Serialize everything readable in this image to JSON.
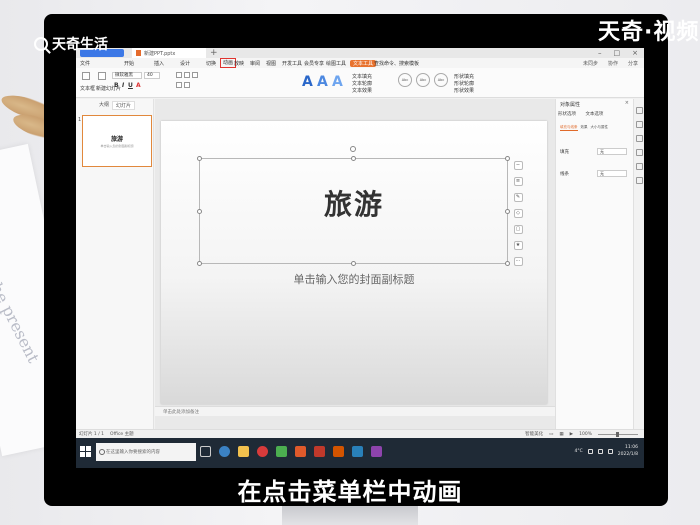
{
  "watermark": {
    "top_left": "天奇生活",
    "top_right": "天奇·视频"
  },
  "caption": "在点击菜单栏中动画",
  "app": {
    "doc_tab": "新建PPT.pptx",
    "menu": [
      "文件",
      "开始",
      "插入",
      "设计",
      "切换",
      "动画",
      "放映",
      "审阅",
      "视图",
      "开发工具",
      "会员专享",
      "绘图工具",
      "文本工具"
    ],
    "search": "查找命令、搜索模板",
    "right_menu": [
      "未同步",
      "协作",
      "分享"
    ],
    "ribbon": {
      "font_name": "微软雅黑",
      "font_size": "40",
      "new_slide": "新建幻灯片",
      "text_box": "文本框",
      "art_letters": [
        "A",
        "A",
        "A"
      ],
      "text_fill": "文本填充",
      "text_outline": "文本轮廓",
      "text_effect": "文本效果",
      "shape_fill": "形状填充",
      "shape_outline": "形状轮廓",
      "shape_effect": "形状效果",
      "style_boxes": [
        "Abc",
        "Abc",
        "Abc"
      ]
    },
    "left_pane": {
      "tabs": [
        "大纲",
        "幻灯片"
      ],
      "slide_num": "1",
      "thumb_title": "旅游",
      "thumb_sub": "单击输入您的封面副标题",
      "add": "+"
    },
    "slide": {
      "title": "旅游",
      "subtitle": "单击输入您的封面副标题"
    },
    "notes": "单击此处添加备注",
    "right_pane": {
      "title": "对象属性",
      "tabs": [
        "形状选项",
        "文本选项"
      ],
      "sub_tabs": [
        "填充与线条",
        "效果",
        "大小与属性"
      ],
      "fill_label": "填充",
      "fill_value": "无",
      "line_label": "线条",
      "line_value": "无"
    },
    "status": {
      "slide": "幻灯片 1 / 1",
      "theme": "Office 主题",
      "smart": "智能美化",
      "zoom": "100%"
    },
    "taskbar": {
      "search": "在这里输入你要搜索的内容",
      "weather": "4°C",
      "time": "11:06",
      "date": "2022/1/8"
    }
  }
}
